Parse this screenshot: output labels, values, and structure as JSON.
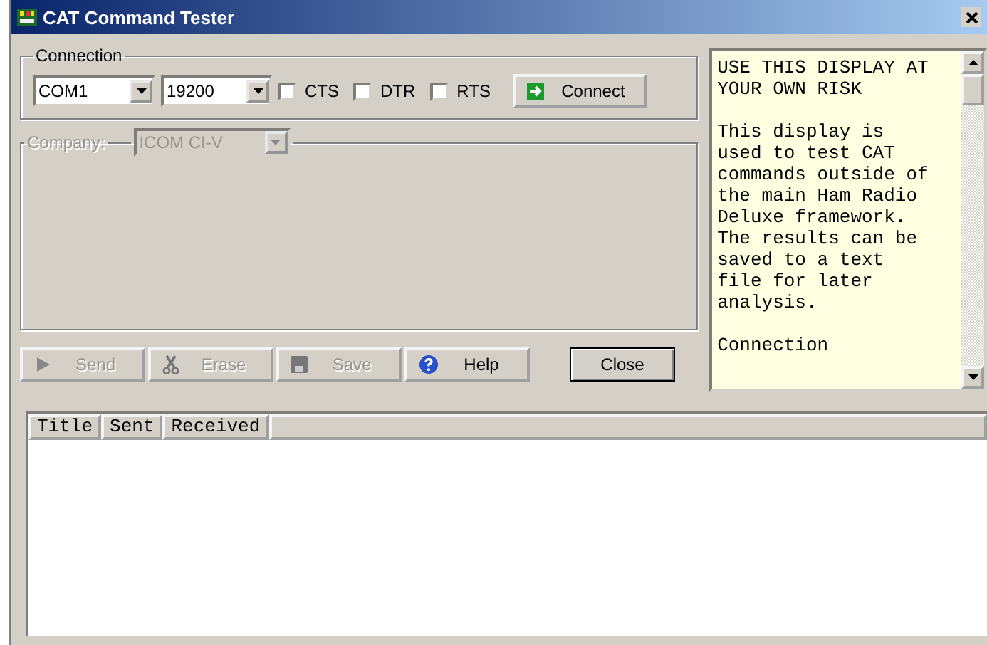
{
  "window": {
    "title": "CAT Command Tester"
  },
  "connection": {
    "label": "Connection",
    "port": "COM1",
    "speed": "19200",
    "options": [
      {
        "label": "CTS",
        "checked": false
      },
      {
        "label": "DTR",
        "checked": false
      },
      {
        "label": "RTS",
        "checked": false
      }
    ],
    "connect_button": "Connect"
  },
  "company": {
    "label": "Company:",
    "value": "ICOM CI-V",
    "disabled": true
  },
  "buttons": [
    {
      "kind": "send",
      "label": "Send",
      "disabled": true
    },
    {
      "kind": "erase",
      "label": "Erase",
      "disabled": true
    },
    {
      "kind": "save",
      "label": "Save",
      "disabled": true
    },
    {
      "kind": "help",
      "label": "Help",
      "disabled": false
    }
  ],
  "close_button": "Close",
  "info": [
    "USE THIS DISPLAY AT YOUR OWN RISK",
    "This display is used to test CAT commands outside of the main Ham Radio Deluxe framework. The results can be saved to a text file for later analysis.",
    "Connection"
  ],
  "table": {
    "columns": [
      "Title",
      "Sent",
      "Received"
    ]
  }
}
